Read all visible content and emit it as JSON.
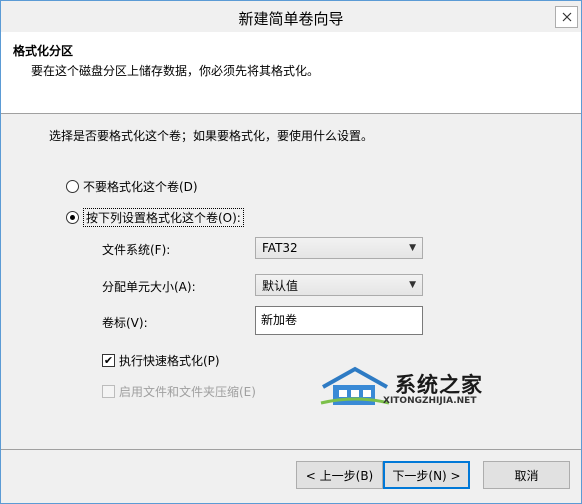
{
  "window": {
    "title": "新建简单卷向导"
  },
  "header": {
    "title": "格式化分区",
    "subtitle": "要在这个磁盘分区上储存数据，你必须先将其格式化。"
  },
  "instruction": "选择是否要格式化这个卷；如果要格式化，要使用什么设置。",
  "options": {
    "no_format": {
      "label": "不要格式化这个卷(D)",
      "selected": false
    },
    "format": {
      "label": "按下列设置格式化这个卷(O):",
      "selected": true
    }
  },
  "fields": {
    "filesystem": {
      "label": "文件系统(F):",
      "value": "FAT32"
    },
    "allocation": {
      "label": "分配单元大小(A):",
      "value": "默认值"
    },
    "volume_label": {
      "label": "卷标(V):",
      "value": "新加卷"
    }
  },
  "checks": {
    "quick_format": {
      "label": "执行快速格式化(P)",
      "checked": true
    },
    "compression": {
      "label": "启用文件和文件夹压缩(E)",
      "checked": false,
      "disabled": true
    }
  },
  "buttons": {
    "back": "< 上一步(B)",
    "next": "下一步(N) >",
    "cancel": "取消"
  },
  "watermark": {
    "text": "系统之家",
    "sub": "XITONGZHIJIA.NET"
  },
  "colors": {
    "accent": "#0078d7",
    "window_border": "#5b9bd5",
    "header_bg": "#ffffff",
    "body_bg": "#f0f0f0"
  },
  "icons": {
    "close": "close-icon",
    "dropdown": "chevron-down-icon",
    "logo": "house-logo-icon"
  }
}
